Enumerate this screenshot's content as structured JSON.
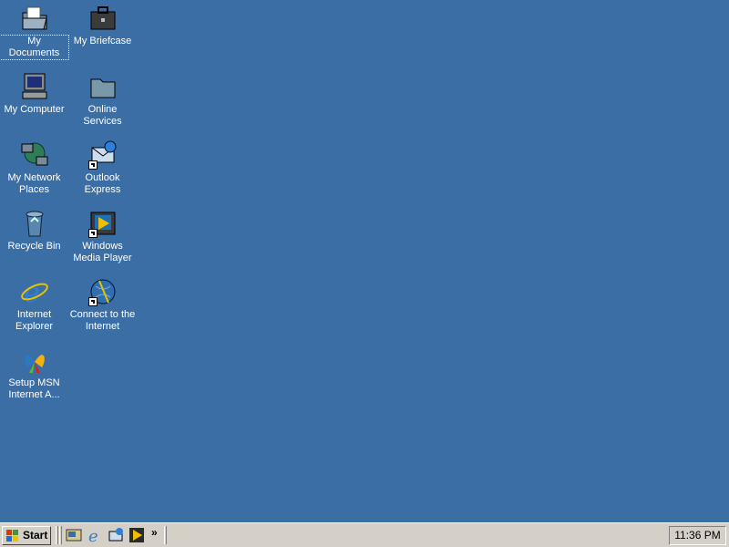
{
  "desktop": {
    "background_color": "#3a6ea5",
    "icons": [
      {
        "label": "My Documents",
        "icon": "folder-documents-icon",
        "selected": true
      },
      {
        "label": "My Briefcase",
        "icon": "briefcase-icon"
      },
      {
        "label": "My Computer",
        "icon": "computer-icon"
      },
      {
        "label": "Online Services",
        "icon": "folder-icon"
      },
      {
        "label": "My Network Places",
        "icon": "network-icon"
      },
      {
        "label": "Outlook Express",
        "icon": "outlook-express-icon",
        "shortcut": true
      },
      {
        "label": "Recycle Bin",
        "icon": "recycle-bin-icon"
      },
      {
        "label": "Windows Media Player",
        "icon": "media-player-icon",
        "shortcut": true
      },
      {
        "label": "Internet Explorer",
        "icon": "internet-explorer-icon"
      },
      {
        "label": "Connect to the Internet",
        "icon": "connect-internet-icon",
        "shortcut": true
      },
      {
        "label": "Setup MSN Internet A...",
        "icon": "msn-butterfly-icon"
      }
    ]
  },
  "taskbar": {
    "start_label": "Start",
    "quick_launch": [
      "show-desktop-icon",
      "internet-explorer-icon",
      "outlook-express-icon",
      "media-player-icon"
    ],
    "chevron": "»",
    "clock": "11:36 PM"
  }
}
